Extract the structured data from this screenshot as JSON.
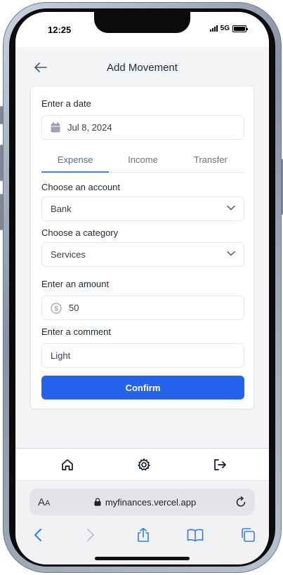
{
  "status_bar": {
    "time": "12:25",
    "network": "5G"
  },
  "header": {
    "title": "Add Movement"
  },
  "form": {
    "date_label": "Enter a date",
    "date_value": "Jul 8, 2024",
    "tabs": [
      {
        "label": "Expense",
        "active": true
      },
      {
        "label": "Income",
        "active": false
      },
      {
        "label": "Transfer",
        "active": false
      }
    ],
    "account_label": "Choose an account",
    "account_value": "Bank",
    "category_label": "Choose a category",
    "category_value": "Services",
    "amount_label": "Enter an amount",
    "amount_value": "50",
    "comment_label": "Enter a comment",
    "comment_value": "Light",
    "confirm_label": "Confirm"
  },
  "bottom_nav": {
    "icons": [
      "home-icon",
      "gear-icon",
      "logout-icon"
    ]
  },
  "browser": {
    "aa_label": "AA",
    "url": "myfinances.vercel.app"
  },
  "colors": {
    "primary": "#2563eb",
    "active_tab": "#3b82f6",
    "background": "#f3f4f6"
  }
}
